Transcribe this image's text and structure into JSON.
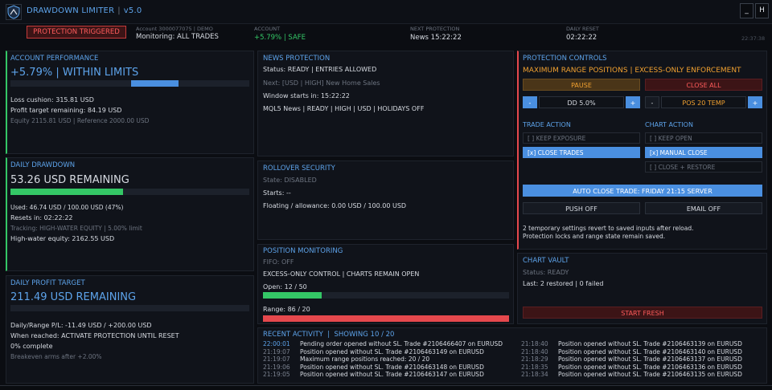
{
  "header": {
    "app_name": "DRAWDOWN LIMITER",
    "version": "v5.0",
    "minimize": "_",
    "hide": "H"
  },
  "status": {
    "badge": "PROTECTION TRIGGERED",
    "account_line": "Account 3000077075  |  DEMO",
    "monitoring": "Monitoring: ALL TRADES",
    "account_label": "ACCOUNT",
    "account_value": "+5.79% | SAFE",
    "news_label": "NEXT PROTECTION",
    "news_value": "News 15:22:22",
    "reset_label": "DAILY RESET",
    "reset_value": "02:22:22",
    "clock": "22:37:38"
  },
  "account_performance": {
    "title": "ACCOUNT PERFORMANCE",
    "headline": "+5.79% | WITHIN LIMITS",
    "progress": 0.5,
    "loss_cushion": "Loss cushion: 315.81 USD",
    "profit_remaining": "Profit target remaining: 84.19 USD",
    "equity": "Equity 2115.81 USD | Reference 2000.00 USD"
  },
  "daily_drawdown": {
    "title": "DAILY DRAWDOWN",
    "headline": "53.26 USD REMAINING",
    "progress": 0.47,
    "used": "Used: 46.74 USD / 100.00 USD (47%)",
    "resets": "Resets in: 02:22:22",
    "tracking": "Tracking: HIGH-WATER EQUITY | 5.00% limit",
    "high_water": "High-water equity: 2162.55 USD"
  },
  "daily_profit": {
    "title": "DAILY PROFIT TARGET",
    "headline": "211.49 USD REMAINING",
    "progress": 0,
    "range": "Daily/Range P/L: -11.49 USD / +200.00 USD",
    "when_reached": "When reached: ACTIVATE PROTECTION UNTIL RESET",
    "complete": "0% complete",
    "breakeven": "Breakeven arms after +2.00%"
  },
  "news": {
    "title": "NEWS PROTECTION",
    "status": "Status: READY | ENTRIES ALLOWED",
    "next": "Next: [USD | HIGH] New Home Sales",
    "window": "Window starts in: 15:22:22",
    "source": "MQL5 News | READY | HIGH | USD | HOLIDAYS OFF"
  },
  "rollover": {
    "title": "ROLLOVER SECURITY",
    "state": "State: DISABLED",
    "starts": "Starts: --",
    "floating": "Floating / allowance: 0.00 USD / 100.00 USD"
  },
  "position_monitoring": {
    "title": "POSITION MONITORING",
    "fifo": "FIFO: OFF",
    "mode": "EXCESS-ONLY CONTROL | CHARTS REMAIN OPEN",
    "open": "Open: 12 / 50",
    "open_progress": 0.24,
    "range": "Range: 86 / 20",
    "range_progress": 1
  },
  "controls": {
    "title": "PROTECTION CONTROLS",
    "subtitle": "MAXIMUM RANGE POSITIONS | EXCESS-ONLY ENFORCEMENT",
    "pause": "PAUSE",
    "close_all": "CLOSE ALL",
    "minus": "-",
    "plus": "+",
    "dd_value": "DD 5.0%",
    "pos_value": "POS 20 TEMP",
    "trade_action_title": "TRADE ACTION",
    "chart_action_title": "CHART ACTION",
    "trade_options": [
      "[ ] KEEP EXPOSURE",
      "[x] CLOSE TRADES"
    ],
    "chart_options": [
      "[ ] KEEP OPEN",
      "[x] MANUAL CLOSE",
      "[ ] CLOSE + RESTORE"
    ],
    "auto_close": "AUTO CLOSE TRADE: FRIDAY 21:15 SERVER",
    "push": "PUSH OFF",
    "email": "EMAIL OFF",
    "note1": "2 temporary settings revert to saved inputs after reload.",
    "note2": "Protection locks and range state remain saved."
  },
  "chart_vault": {
    "title": "CHART VAULT",
    "status": "Status: READY",
    "last": "Last: 2 restored | 0 failed",
    "start_fresh": "START FRESH"
  },
  "activity": {
    "title": "RECENT ACTIVITY  |  SHOWING 10 / 20",
    "left": [
      {
        "time": "22:00:01",
        "text": "Pending order opened without SL. Trade #2106466407 on EURUSD"
      },
      {
        "time": "21:19:07",
        "text": "Position opened without SL. Trade #2106463149 on EURUSD"
      },
      {
        "time": "21:19:07",
        "text": "Maximum range positions reached: 20 / 20"
      },
      {
        "time": "21:19:06",
        "text": "Position opened without SL. Trade #2106463148 on EURUSD"
      },
      {
        "time": "21:19:05",
        "text": "Position opened without SL. Trade #2106463147 on EURUSD"
      }
    ],
    "right": [
      {
        "time": "21:18:40",
        "text": "Position opened without SL. Trade #2106463139 on EURUSD"
      },
      {
        "time": "21:18:40",
        "text": "Position opened without SL. Trade #2106463140 on EURUSD"
      },
      {
        "time": "21:18:29",
        "text": "Position opened without SL. Trade #2106463137 on EURUSD"
      },
      {
        "time": "21:18:35",
        "text": "Position opened without SL. Trade #2106463136 on EURUSD"
      },
      {
        "time": "21:18:34",
        "text": "Position opened without SL. Trade #2106463135 on EURUSD"
      }
    ]
  },
  "colors": {
    "accent": "#5da3ea",
    "good": "#34c766",
    "warn": "#f0a030",
    "bad": "#e5484d"
  }
}
